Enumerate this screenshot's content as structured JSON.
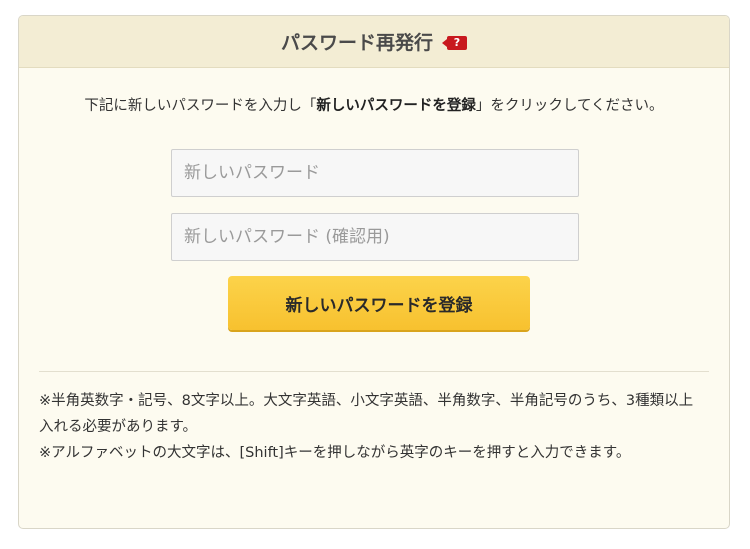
{
  "header": {
    "title": "パスワード再発行",
    "help_icon_symbol": "?",
    "help_icon_color": "#c8191e"
  },
  "instruction": {
    "before": "下記に新しいパスワードを入力し「",
    "emphasis": "新しいパスワードを登録",
    "after": "」をクリックしてください。"
  },
  "form": {
    "new_password_placeholder": "新しいパスワード",
    "confirm_password_placeholder": "新しいパスワード (確認用)",
    "submit_label": "新しいパスワードを登録",
    "submit_color": "#f7c12f"
  },
  "notes": [
    "※半角英数字・記号、8文字以上。大文字英語、小文字英語、半角数字、半角記号のうち、3種類以上入れる必要があります。",
    "※アルファベットの大文字は、[Shift]キーを押しながら英字のキーを押すと入力できます。"
  ]
}
